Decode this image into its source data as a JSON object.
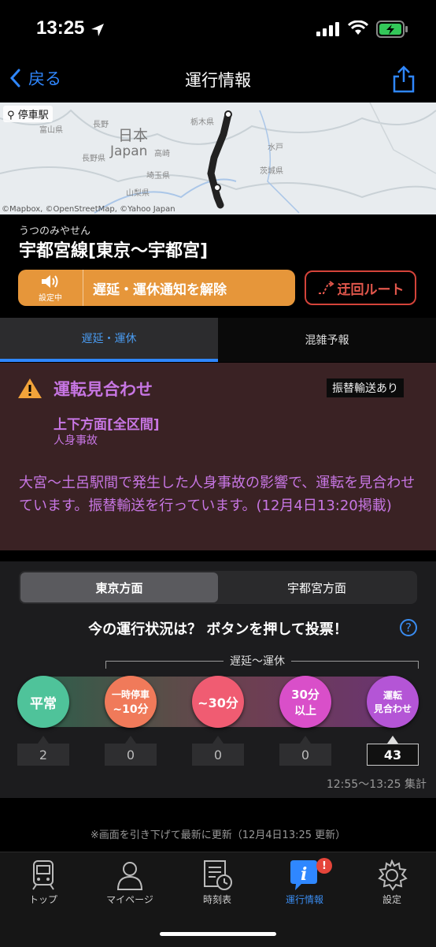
{
  "status": {
    "time": "13:25"
  },
  "nav": {
    "back_label": "戻る",
    "title": "運行情報"
  },
  "map": {
    "stop_label": "停車駅",
    "attribution": "©Mapbox, ©OpenStreetMap, ©Yahoo Japan",
    "place_labels": [
      "日本",
      "Japan",
      "長野",
      "富山県",
      "栃木県",
      "茨城県",
      "埼玉県",
      "山梨県",
      "水戸",
      "長野県",
      "高崎"
    ]
  },
  "line": {
    "ruby": "うつのみやせん",
    "name": "宇都宮線[東京〜宇都宮]"
  },
  "notify": {
    "status": "設定中",
    "label": "遅延・運休通知を解除"
  },
  "detour": {
    "label": "迂回ルート"
  },
  "tabs": [
    {
      "label": "遅延・運休"
    },
    {
      "label": "混雑予報"
    }
  ],
  "alert": {
    "title": "運転見合わせ",
    "badge": "振替輸送あり",
    "direction": "上下方面[全区間]",
    "cause": "人身事故",
    "description": "大宮〜土呂駅間で発生した人身事故の影響で、運転を見合わせています。振替輸送を行っています。(12月4日13:20掲載)"
  },
  "vote": {
    "segments": [
      {
        "label": "東京方面"
      },
      {
        "label": "宇都宮方面"
      }
    ],
    "question": "今の運行状況は？ ボタンを押して投票！",
    "help": "?",
    "bracket_label": "遅延〜運休",
    "options": [
      {
        "line1": "平常",
        "line2": "",
        "count": "2",
        "color": "#4fc39a"
      },
      {
        "line1": "一時停車",
        "line2": "~10分",
        "count": "0",
        "color": "#f07a5a"
      },
      {
        "line1": "~30分",
        "line2": "",
        "count": "0",
        "color": "#f05c72"
      },
      {
        "line1": "30分",
        "line2": "以上",
        "count": "0",
        "color": "#d94fc9"
      },
      {
        "line1": "運転",
        "line2": "見合わせ",
        "count": "43",
        "color": "#b455d6"
      }
    ],
    "period": "12:55〜13:25 集計"
  },
  "refresh_note": "※画面を引き下げて最新に更新（12月4日13:25 更新）",
  "tabbar": [
    {
      "label": "トップ",
      "icon": "train-icon"
    },
    {
      "label": "マイページ",
      "icon": "person-icon"
    },
    {
      "label": "時刻表",
      "icon": "timetable-icon"
    },
    {
      "label": "運行情報",
      "icon": "info-icon",
      "badge": "!"
    },
    {
      "label": "設定",
      "icon": "gear-icon"
    }
  ],
  "colors": {
    "accent": "#2f87ff",
    "alert_text": "#c776e3",
    "notify_bg": "#e6963a",
    "detour": "#d4433a"
  }
}
